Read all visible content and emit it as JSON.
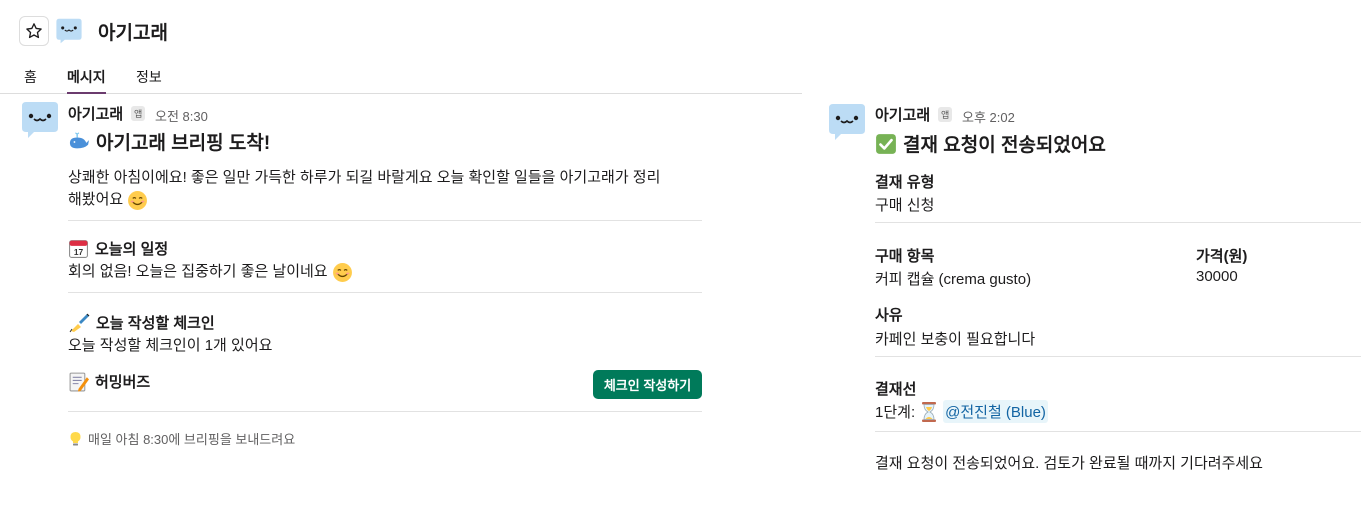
{
  "header": {
    "title": "아기고래"
  },
  "tabs": [
    {
      "label": "홈"
    },
    {
      "label": "메시지"
    },
    {
      "label": "정보"
    }
  ],
  "left_message": {
    "sender": "아기고래",
    "badge": "앱",
    "time": "오전 8:30",
    "title": "아기고래 브리핑 도착!",
    "intro_line1": "상쾌한 아침이에요! 좋은 일만 가득한 하루가 되길 바랄게요 오늘 확인할 일들을 아기고래가 정리",
    "intro_line2": "해봤어요",
    "schedule_title": "오늘의 일정",
    "schedule_text": "회의 없음! 오늘은 집중하기 좋은 날이네요",
    "checkin_title": "오늘 작성할 체크인",
    "checkin_text": "오늘 작성할 체크인이 1개 있어요",
    "humming_title": "허밍버즈",
    "checkin_button": "체크인 작성하기",
    "hint": "매일 아침 8:30에 브리핑을 보내드려요"
  },
  "right_message": {
    "sender": "아기고래",
    "badge": "앱",
    "time": "오후 2:02",
    "title": "결재 요청이 전송되었어요",
    "type_label": "결재 유형",
    "type_value": "구매 신청",
    "item_label": "구매 항목",
    "item_value": "커피 캡슐 (crema gusto)",
    "price_label": "가격(원)",
    "price_value": "30000",
    "reason_label": "사유",
    "reason_value": "카페인 보충이 필요합니다",
    "approval_label": "결재선",
    "approval_step": "1단계:",
    "approval_mention": "@전진철 (Blue)",
    "footer": "결재 요청이 전송되었어요. 검토가 완료될 때까지 기다려주세요"
  },
  "colors": {
    "accent_tab": "#6b3b6e",
    "button_green": "#007a5a",
    "mention_bg": "#e8f5fa",
    "mention_text": "#1264a3",
    "avatar_bg": "#bcdcf5"
  }
}
